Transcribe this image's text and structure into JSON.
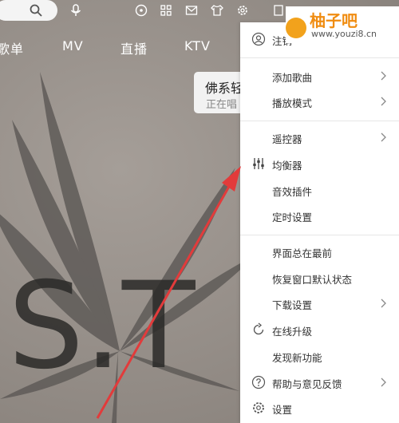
{
  "nav": {
    "items": [
      "歌单",
      "MV",
      "直播",
      "KTV"
    ]
  },
  "now_playing": {
    "title": "佛系轻",
    "status": "正在唱"
  },
  "watermark": {
    "title": "柚子吧",
    "url": "www.youzi8.cn"
  },
  "artwork": {
    "letters": "S.T"
  },
  "menu": {
    "logout": "注销",
    "add_song": "添加歌曲",
    "play_mode": "播放模式",
    "remote": "遥控器",
    "equalizer": "均衡器",
    "effects": "音效插件",
    "timer": "定时设置",
    "always_on_top": "界面总在最前",
    "restore_window": "恢复窗口默认状态",
    "download_settings": "下载设置",
    "online_upgrade": "在线升级",
    "discover": "发现新功能",
    "help_feedback": "帮助与意见反馈",
    "settings": "设置"
  },
  "colors": {
    "accent_red": "#e23b3b",
    "watermark_orange": "#f08c10",
    "menu_text": "#333333"
  }
}
